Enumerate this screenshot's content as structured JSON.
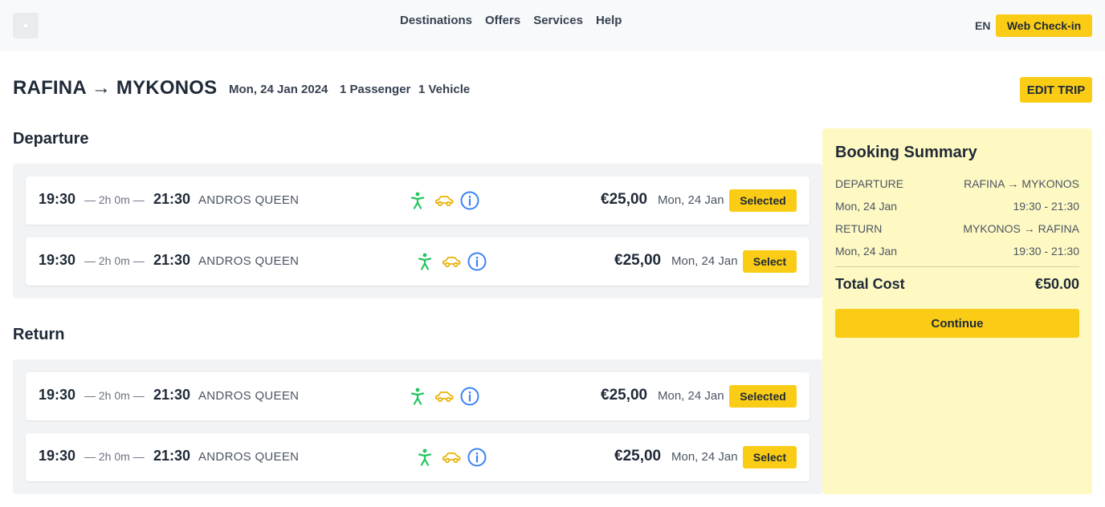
{
  "header": {
    "nav": [
      "Destinations",
      "Offers",
      "Services",
      "Help"
    ],
    "lang": "EN",
    "checkin_label": "Web Check-in"
  },
  "trip": {
    "route": "RAFINA → MYKONOS",
    "date": "Mon, 24 Jan 2024",
    "passengers": "1 Passenger",
    "vehicles": "1 Vehicle",
    "edit_label": "EDIT TRIP"
  },
  "departure": {
    "title": "Departure",
    "trips": [
      {
        "depart": "19:30",
        "duration": "— 2h 0m —",
        "arrive": "21:30",
        "ship": "ANDROS QUEEN",
        "price": "€25,00",
        "date": "Mon, 24 Jan",
        "action": "Selected"
      },
      {
        "depart": "19:30",
        "duration": "— 2h 0m —",
        "arrive": "21:30",
        "ship": "ANDROS QUEEN",
        "price": "€25,00",
        "date": "Mon, 24 Jan",
        "action": "Select"
      }
    ]
  },
  "return": {
    "title": "Return",
    "trips": [
      {
        "depart": "19:30",
        "duration": "— 2h 0m —",
        "arrive": "21:30",
        "ship": "ANDROS QUEEN",
        "price": "€25,00",
        "date": "Mon, 24 Jan",
        "action": "Selected"
      },
      {
        "depart": "19:30",
        "duration": "— 2h 0m —",
        "arrive": "21:30",
        "ship": "ANDROS QUEEN",
        "price": "€25,00",
        "date": "Mon, 24 Jan",
        "action": "Select"
      }
    ]
  },
  "summary": {
    "title": "Booking Summary",
    "departure_label": "DEPARTURE",
    "departure_route": "RAFINA → MYKONOS",
    "departure_date": "Mon, 24 Jan",
    "departure_time": "19:30 - 21:30",
    "return_label": "RETURN",
    "return_route": "MYKONOS → RAFINA",
    "return_date": "Mon, 24 Jan",
    "return_time": "19:30 - 21:30",
    "total_label": "Total Cost",
    "total_value": "€50.00",
    "continue_label": "Continue"
  },
  "icons": {
    "passenger": "accessibility-icon",
    "vehicle": "car-icon",
    "info": "info-icon"
  },
  "colors": {
    "accent": "#facc15",
    "summary_bg": "#fef9c3",
    "passenger_icon": "#22c55e",
    "vehicle_icon": "#eab308",
    "info_icon": "#3b82f6"
  }
}
